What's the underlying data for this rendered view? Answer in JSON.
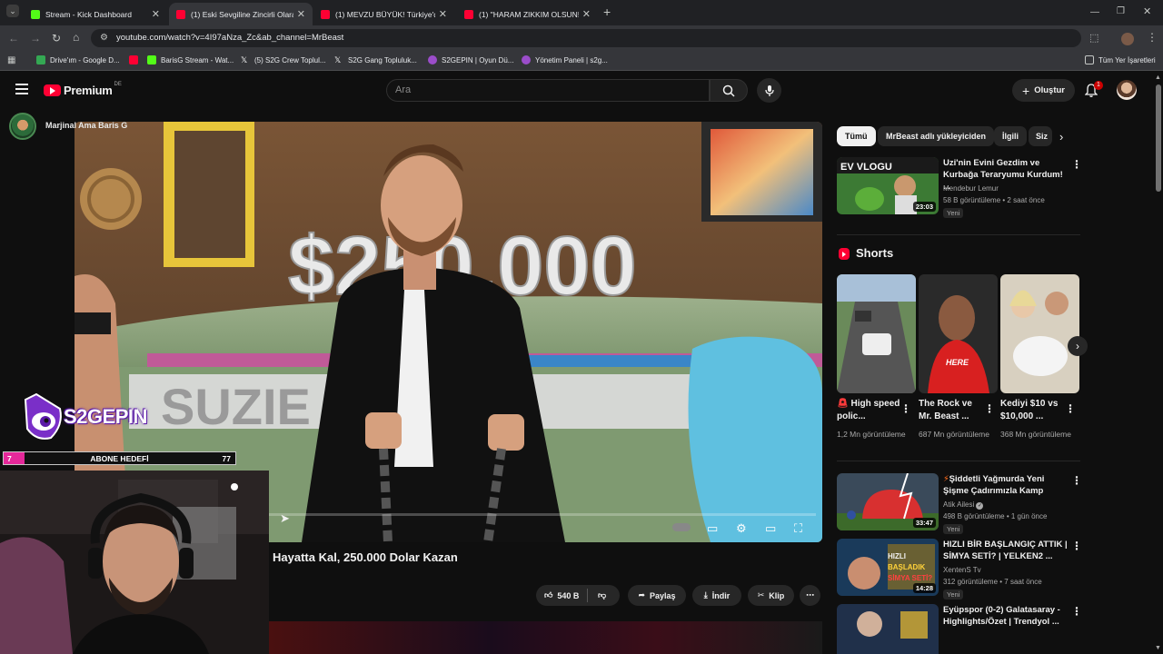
{
  "browser": {
    "tabs": [
      {
        "title": "Stream - Kick Dashboard",
        "favicon_color": "#53fc18",
        "active": false
      },
      {
        "title": "(1) Eski Sevgiline Zincirli Olarak",
        "favicon_color": "#ff0033",
        "active": true
      },
      {
        "title": "(1) MEVZU BÜYÜK! Türkiye'deki",
        "favicon_color": "#ff0033",
        "active": false
      },
      {
        "title": "(1) \"HARAM ZIKKIM OLSUN!\" T",
        "favicon_color": "#ff0033",
        "active": false
      }
    ],
    "new_tab_label": "+",
    "url": "youtube.com/watch?v=4I97aNza_Zc&ab_channel=MrBeast",
    "bookmarks": [
      {
        "label": "Drive'ım - Google D...",
        "icon_color": "#34a853"
      },
      {
        "label": "",
        "icon_color": "#ff0033"
      },
      {
        "label": "BarisG Stream - Wat...",
        "icon_color": "#53fc18"
      },
      {
        "label": "(5) S2G Crew Toplul...",
        "icon_color": "#ffffff"
      },
      {
        "label": "S2G Gang Topluluk...",
        "icon_color": "#ffffff"
      },
      {
        "label": "S2GEPIN | Oyun Dü...",
        "icon_color": "#9b4dca"
      },
      {
        "label": "Yönetim Paneli | s2g...",
        "icon_color": "#9b4dca"
      }
    ],
    "all_bookmarks_label": "Tüm Yer İşaretleri"
  },
  "youtube": {
    "logo_text": "Premium",
    "region": "DE",
    "search_placeholder": "Ara",
    "create_label": "Oluştur",
    "notification_count": "1"
  },
  "video": {
    "title": "Hayatta Kal, 250.000 Dolar Kazan",
    "likes": "540 B",
    "share_label": "Paylaş",
    "download_label": "İndir",
    "clip_label": "Klip",
    "overlay_sign": "$250,000",
    "overlay_names": "SUZIE    JOSH"
  },
  "stream_overlay": {
    "channel_name": "Marjinal Ama Baris G",
    "logo_text": "S2GEPIN",
    "goal_label": "ABONE HEDEFİ",
    "goal_current": "7",
    "goal_target": "77",
    "goal_progress": 0.09
  },
  "sidebar": {
    "chips": [
      "Tümü",
      "MrBeast adlı yükleyiciden",
      "İlgili",
      "Siz"
    ],
    "top_video": {
      "title": "Uzi'nin Evini Gezdim ve Kurbağa Teraryumu Kurdum! ...",
      "channel": "Mendebur Lemur",
      "meta": "58 B görüntüleme • 2 saat önce",
      "badge": "Yeni",
      "duration": "23:03",
      "thumb_text": "EV VLOGU"
    },
    "shorts_heading": "Shorts",
    "shorts": [
      {
        "title": "High speed polic...",
        "views": "1,2 Mn görüntüleme"
      },
      {
        "title": "The Rock ve Mr. Beast ...",
        "views": "687 Mn görüntüleme"
      },
      {
        "title": "Kediyi $10 vs $10,000 ...",
        "views": "368 Mn görüntüleme"
      }
    ],
    "videos": [
      {
        "title": "Şiddetli Yağmurda Yeni Şişme Çadırımızla Kamp",
        "channel": "Atik Ailesi",
        "meta": "498 B görüntüleme • 1 gün önce",
        "badge": "Yeni",
        "duration": "33:47"
      },
      {
        "title": "HIZLI BİR BAŞLANGIÇ ATTIK | SİMYA SETİ? | YELKEN2 ...",
        "channel": "XentenS Tv",
        "meta": "312 görüntüleme • 7 saat önce",
        "badge": "Yeni",
        "duration": "14:28"
      },
      {
        "title": "Eyüpspor (0-2) Galatasaray - Highlights/Özet | Trendyol ...",
        "channel": "",
        "meta": "",
        "badge": "",
        "duration": ""
      }
    ]
  }
}
